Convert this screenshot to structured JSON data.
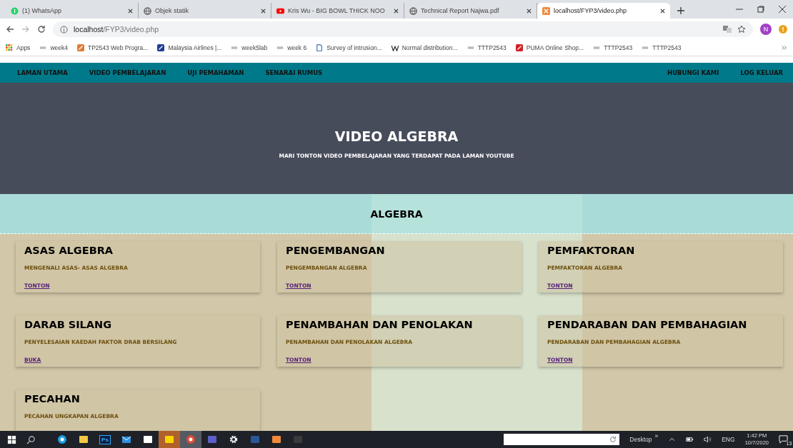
{
  "browser": {
    "tabs": [
      {
        "title": "(1) WhatsApp",
        "kind": "whatsapp",
        "selected": false
      },
      {
        "title": "Objek statik",
        "kind": "globe",
        "selected": false
      },
      {
        "title": "Kris Wu - BIG BOWL THICK NOO",
        "kind": "youtube",
        "selected": false
      },
      {
        "title": "Technical Report Najwa.pdf",
        "kind": "globe",
        "selected": false
      },
      {
        "title": "localhost/FYP3/video.php",
        "kind": "xampp",
        "selected": true
      }
    ],
    "address": {
      "host": "localhost",
      "path": "/FYP3/video.php"
    },
    "profile_initial": "N",
    "bookmarks": [
      {
        "label": "Apps",
        "kind": "apps"
      },
      {
        "label": "week4",
        "kind": "folder"
      },
      {
        "label": "TP2543 Web Progra...",
        "kind": "xampp"
      },
      {
        "label": "Malaysia Airlines |...",
        "kind": "airline"
      },
      {
        "label": "week5lab",
        "kind": "folder"
      },
      {
        "label": "week 6",
        "kind": "folder"
      },
      {
        "label": "Survey of intrusion...",
        "kind": "survey"
      },
      {
        "label": "Normal distribution...",
        "kind": "wiki"
      },
      {
        "label": "TTTP2543",
        "kind": "folder"
      },
      {
        "label": "PUMA Online Shop...",
        "kind": "puma"
      },
      {
        "label": "TTTP2543",
        "kind": "folder"
      },
      {
        "label": "TTTP2543",
        "kind": "folder"
      }
    ]
  },
  "nav": {
    "left": [
      {
        "label": "LAMAN UTAMA",
        "selected": false
      },
      {
        "label": "VIDEO PEMBELAJARAN",
        "selected": false
      },
      {
        "label": "UJI PEMAHAMAN",
        "selected": false
      },
      {
        "label": "SENARAI RUMUS",
        "selected": false
      }
    ],
    "right": [
      {
        "label": "HUBUNGI KAMI",
        "selected": false
      },
      {
        "label": "LOG KELUAR",
        "selected": false
      }
    ]
  },
  "hero": {
    "title": "VIDEO ALGEBRA",
    "subtitle": "MARI TONTON VIDEO PEMBELAJARAN YANG TERDAPAT PADA LAMAN YOUTUBE"
  },
  "section": {
    "title": "ALGEBRA"
  },
  "cards": [
    {
      "title": "ASAS ALGEBRA",
      "description": "MENGENALI ASAS- ASAS ALGEBRA",
      "link": "TONTON"
    },
    {
      "title": "PENGEMBANGAN",
      "description": "PENGEMBANGAN ALGEBRA",
      "link": "TONTON"
    },
    {
      "title": "PEMFAKTORAN",
      "description": "PEMFAKTORAN ALGEBRA",
      "link": "TONTON"
    },
    {
      "title": "DARAB SILANG",
      "description": "PENYELESAIAN KAEDAH FAKTOR DRAB BERSILANG",
      "link": "BUKA"
    },
    {
      "title": "PENAMBAHAN DAN PENOLAKAN",
      "description": "PENAMBAHAN DAN PENOLAKAN ALGEBRA",
      "link": "TONTON"
    },
    {
      "title": "PENDARABAN DAN PEMBAHAGIAN",
      "description": "PENDARABAN DAN PEMBAHAGIAN ALGEBRA",
      "link": "TONTON"
    },
    {
      "title": "PECAHAN",
      "description": "PECAHAN UNGKAPAN ALGEBRA"
    }
  ],
  "taskbar": {
    "apps": [
      {
        "kind": "edge",
        "active": false
      },
      {
        "kind": "explorer",
        "active": false
      },
      {
        "kind": "photoshop",
        "label": "Ps",
        "active": false
      },
      {
        "kind": "mail",
        "active": false
      },
      {
        "kind": "store",
        "active": false
      },
      {
        "kind": "sticky",
        "active": true
      },
      {
        "kind": "chrome",
        "active": true
      },
      {
        "kind": "teams",
        "active": false
      },
      {
        "kind": "settings",
        "active": false
      },
      {
        "kind": "word",
        "active": false
      },
      {
        "kind": "xampp",
        "active": false
      },
      {
        "kind": "sublime",
        "active": false
      }
    ],
    "toolbar_label": "Desktop",
    "overflow": "»",
    "language": "ENG",
    "time": "1:42 PM",
    "date": "10/7/2020",
    "notifications": "13"
  }
}
